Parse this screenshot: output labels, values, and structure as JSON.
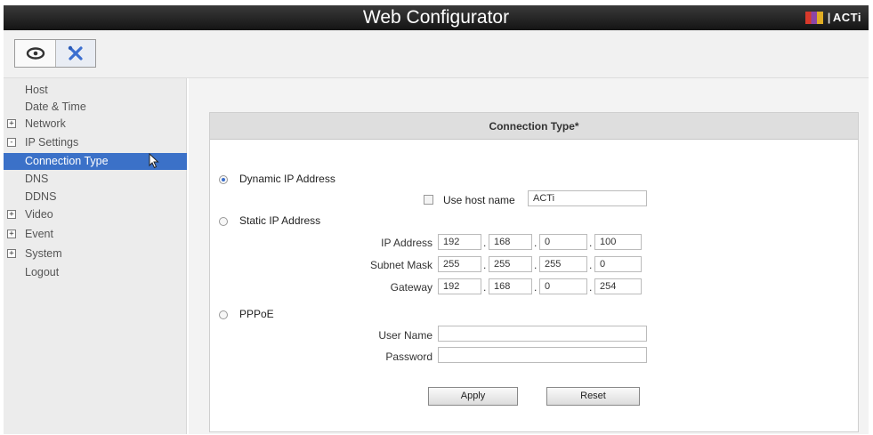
{
  "app": {
    "title": "Web Configurator",
    "brand": "ACTi"
  },
  "toolbar": {
    "view_icon": "eye-icon",
    "settings_icon": "tools-icon"
  },
  "sidebar": {
    "items": [
      {
        "label": "Host",
        "expander": ""
      },
      {
        "label": "Date & Time",
        "expander": ""
      },
      {
        "label": "Network",
        "expander": "+"
      },
      {
        "label": "IP Settings",
        "expander": "-"
      },
      {
        "label": "Connection Type",
        "expander": ""
      },
      {
        "label": "DNS",
        "expander": ""
      },
      {
        "label": "DDNS",
        "expander": ""
      },
      {
        "label": "Video",
        "expander": "+"
      },
      {
        "label": "Event",
        "expander": "+"
      },
      {
        "label": "System",
        "expander": "+"
      },
      {
        "label": "Logout",
        "expander": ""
      }
    ],
    "active": "Connection Type"
  },
  "panel": {
    "title": "Connection Type*",
    "dynamic": {
      "label": "Dynamic IP Address",
      "selected": true
    },
    "use_host_name": {
      "label": "Use host name",
      "checked": false,
      "value": "ACTi"
    },
    "static": {
      "label": "Static IP Address",
      "selected": false
    },
    "ip_address": {
      "label": "IP Address",
      "octets": [
        "192",
        "168",
        "0",
        "100"
      ]
    },
    "subnet_mask": {
      "label": "Subnet Mask",
      "octets": [
        "255",
        "255",
        "255",
        "0"
      ]
    },
    "gateway": {
      "label": "Gateway",
      "octets": [
        "192",
        "168",
        "0",
        "254"
      ]
    },
    "separator": ".",
    "pppoe": {
      "label": "PPPoE",
      "selected": false
    },
    "user_name": {
      "label": "User Name",
      "value": ""
    },
    "password": {
      "label": "Password",
      "value": ""
    },
    "apply_label": "Apply",
    "reset_label": "Reset"
  },
  "colors": {
    "active_item": "#3b71c8",
    "titlebar": "#1c1c1c"
  }
}
